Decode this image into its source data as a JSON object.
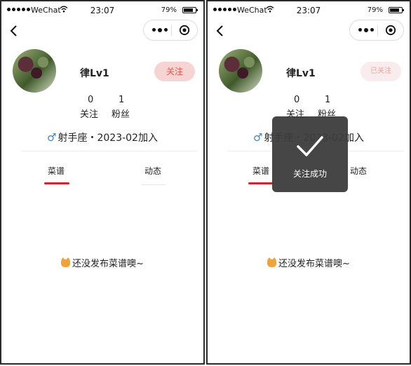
{
  "statusbar": {
    "carrier": "WeChat",
    "time": "23:07",
    "battery": "79%"
  },
  "profile": {
    "nickname": "律Lv1",
    "following_count": "0",
    "following_label": "关注",
    "followers_count": "1",
    "followers_label": "粉丝",
    "gender_symbol": "♂",
    "info": "射手座・2023-02加入"
  },
  "left_screen": {
    "follow_button_label": "关注"
  },
  "right_screen": {
    "follow_button_label": "已关注",
    "toast_text": "关注成功"
  },
  "tabs": {
    "recipes": "菜谱",
    "moments": "动态"
  },
  "empty_state": {
    "text": "还没发布菜谱噢~"
  },
  "icons": {
    "back": "chevron-left-icon",
    "more": "more-dots-icon",
    "capsule_close": "target-circle-icon",
    "toast": "checkmark-icon",
    "empty": "cat-emoji-icon"
  },
  "colors": {
    "accent": "#d8232a",
    "follow_bg": "#f6d4d3",
    "follow_text": "#e4564f",
    "toast_bg": "#3c3c3c"
  }
}
